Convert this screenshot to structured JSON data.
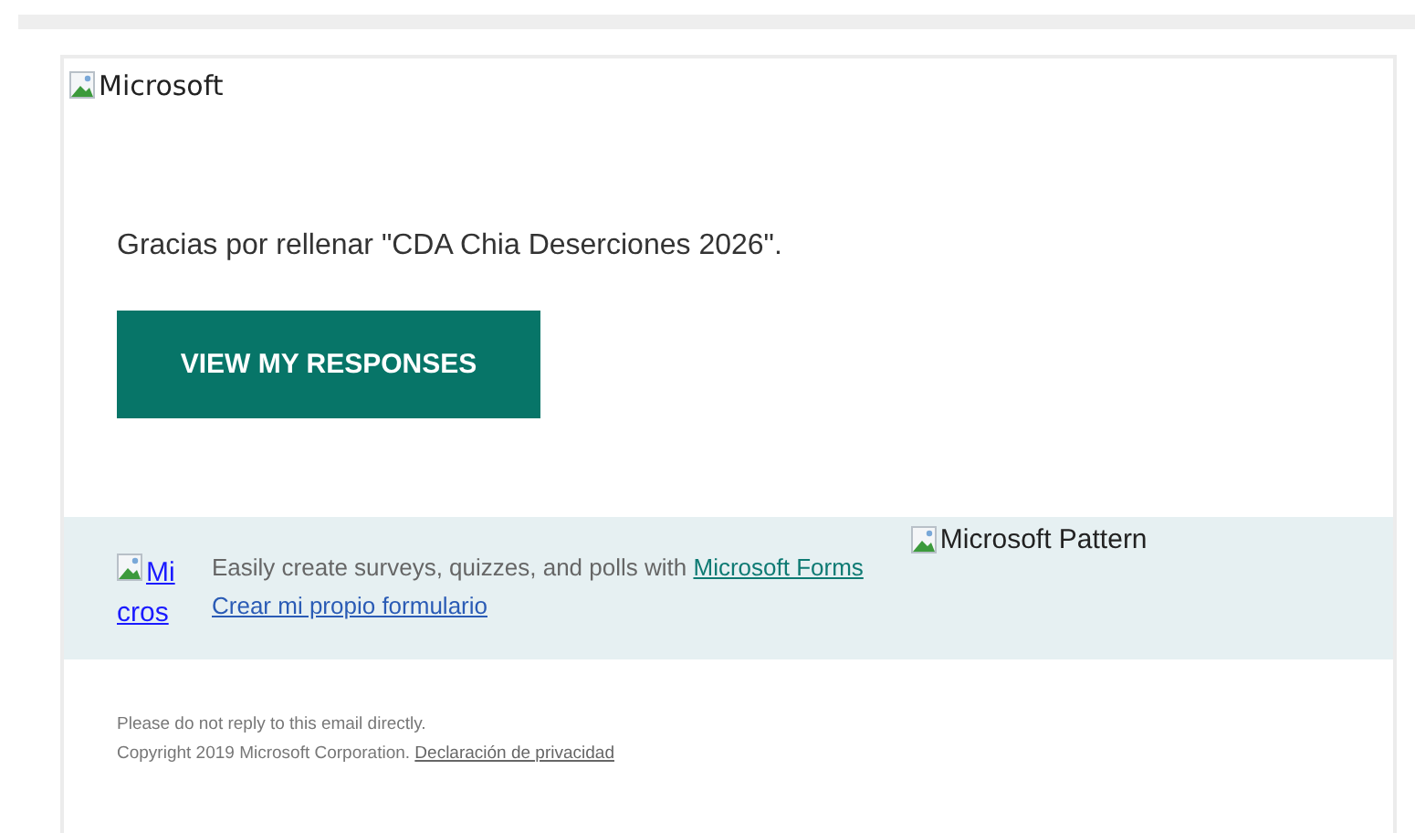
{
  "header": {
    "logo_alt": "Microsoft"
  },
  "message": "Gracias por rellenar \"CDA Chia Deserciones 2026\".",
  "button": {
    "label": "VIEW MY RESPONSES"
  },
  "promo": {
    "logo_alt_lines": [
      "Mi",
      "cros"
    ],
    "text": "Easily create surveys, quizzes, and polls with",
    "link": "Microsoft Forms",
    "create_link": "Crear mi propio formulario",
    "pattern_alt": "Microsoft Pattern"
  },
  "footer": {
    "line1": "Please do not reply to this email directly.",
    "copyright": "Copyright 2019 Microsoft Corporation.",
    "privacy_link": "Declaración de privacidad"
  }
}
